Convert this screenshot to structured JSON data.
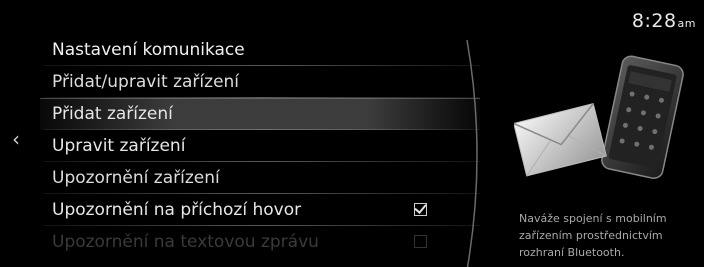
{
  "status": {
    "time": "8:28",
    "ampm": "am"
  },
  "nav": {
    "back": "‹"
  },
  "menu": {
    "title": "Nastavení komunikace",
    "items": [
      {
        "label": "Přidat/upravit zařízení"
      },
      {
        "label": "Přidat zařízení"
      },
      {
        "label": "Upravit zařízení"
      },
      {
        "label": "Upozornění zařízení"
      },
      {
        "label": "Upozornění na příchozí hovor",
        "checked": true
      },
      {
        "label": "Upozornění na textovou zprávu",
        "checked": true
      }
    ]
  },
  "info": {
    "description": "Naváže spojení s mobilním zařízením prostřednictvím rozhraní Bluetooth."
  },
  "colors": {
    "background": "#000000",
    "text": "#e6e6e6",
    "selection": "#464646",
    "description": "#a9a9a9"
  }
}
